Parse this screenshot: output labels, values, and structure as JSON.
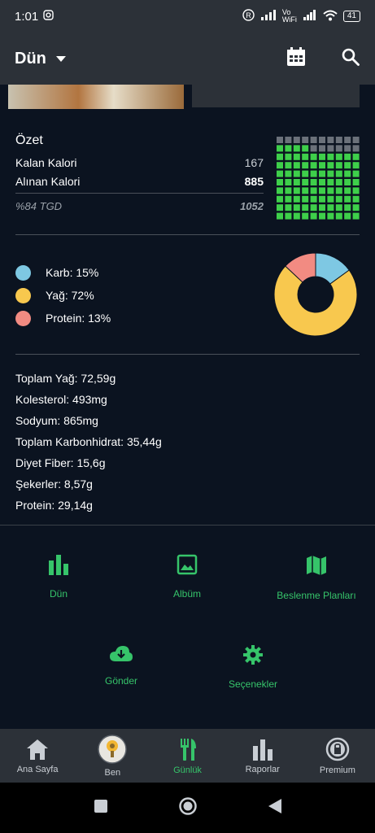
{
  "status_bar": {
    "time": "1:01",
    "network_text": "Vo\nWiFi",
    "battery": "41"
  },
  "app_bar": {
    "title": "Dün"
  },
  "summary": {
    "heading": "Özet",
    "remaining_label": "Kalan Kalori",
    "remaining_value": "167",
    "consumed_label": "Alınan Kalori",
    "consumed_value": "885",
    "tdee_label": "%84 TGD",
    "tdee_value": "1052",
    "grid_fill_fraction": 0.84
  },
  "macros": {
    "items": [
      {
        "label": "Karb: 15%",
        "color": "#7ec8e3",
        "percent": 15
      },
      {
        "label": "Yağ: 72%",
        "color": "#f8c84e",
        "percent": 72
      },
      {
        "label": "Protein: 13%",
        "color": "#f28b82",
        "percent": 13
      }
    ]
  },
  "nutrients": [
    "Toplam Yağ: 72,59g",
    "Kolesterol: 493mg",
    "Sodyum: 865mg",
    "Toplam Karbonhidrat: 35,44g",
    "Diyet Fiber: 15,6g",
    "Şekerler: 8,57g",
    "Protein: 29,14g"
  ],
  "actions": {
    "day": "Dün",
    "album": "Albüm",
    "meal_plans": "Beslenme Planları",
    "send": "Gönder",
    "options": "Seçenekler"
  },
  "bottom_nav": {
    "home": "Ana Sayfa",
    "me": "Ben",
    "diary": "Günlük",
    "reports": "Raporlar",
    "premium": "Premium"
  },
  "colors": {
    "accent": "#36c46a",
    "background": "#0b1320",
    "bar": "#2c3138"
  }
}
